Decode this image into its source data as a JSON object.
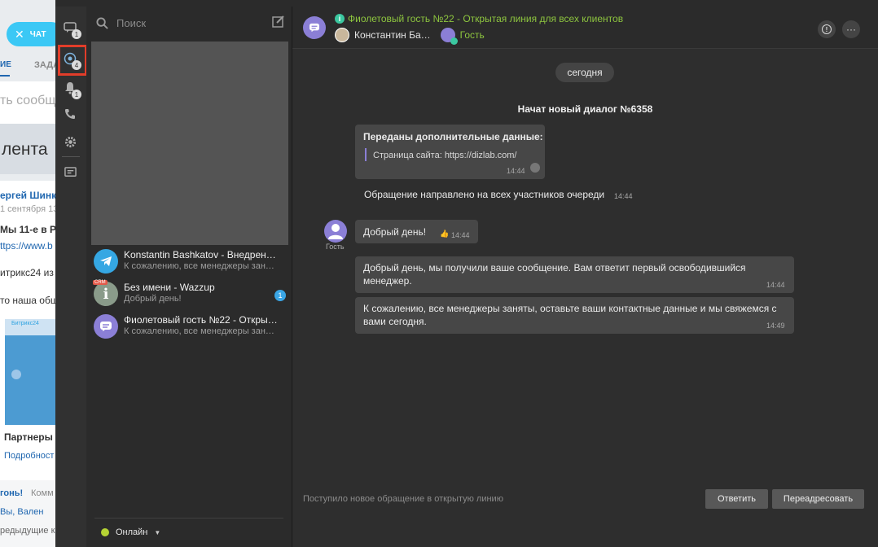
{
  "portal_bg": {
    "chat_button": "ЧАТ",
    "tab_active": "ИЕ",
    "tab_tasks": "ЗАДА",
    "placeholder": "ть сообще",
    "feed": "лента",
    "author": "ергей Шинк",
    "date": "1 сентября 13",
    "post_title": "Мы 11-е в Ро",
    "link": "ttps://www.b",
    "text1": "итрикс24 из",
    "text2": "то наша обш",
    "partners": "Партнеры",
    "more": "Подробност",
    "comment_author": "гонь!",
    "comment_label": "Комм",
    "you": "Вы, Вален",
    "prev": "редыдущие к"
  },
  "rail": {
    "chats_badge": "1",
    "openlines_badge": "4",
    "notifications_badge": "1"
  },
  "list": {
    "search_placeholder": "Поиск",
    "items": [
      {
        "name": "Konstantin Bashkatov - Внедрен…",
        "message": "К сожалению, все менеджеры зан…",
        "icon": "telegram-icon",
        "color": "#35a7e3"
      },
      {
        "name": "Без имени - Wazzup",
        "message": "Добрый день!",
        "icon": "info-icon",
        "color": "#8a9b8a",
        "badge": "1",
        "tag": "CRM"
      },
      {
        "name": "Фиолетовый гость №22 - Откры…",
        "message": "К сожалению, все менеджеры зан…",
        "icon": "openline-icon",
        "color": "#8b7fd6"
      }
    ],
    "status": "Онлайн"
  },
  "dialog": {
    "title": "Фиолетовый гость №22 - Открытая линия для всех клиентов",
    "operator": "Константин Ба…",
    "guest": "Гость",
    "date_divider": "сегодня",
    "new_dialog": "Начат новый диалог №6358",
    "extra_data_title": "Переданы дополнительные данные:",
    "extra_data_line": "Страница сайта: https://dizlab.com/",
    "extra_data_time": "14:44",
    "system_message": "Обращение направлено на всех участников очереди",
    "system_time": "14:44",
    "guest_label": "Гость",
    "guest_message": "Добрый день!",
    "guest_time": "14:44",
    "bot_message1": "Добрый день, мы получили ваше сообщение. Вам ответит первый освободившийся менеджер.",
    "bot_time1": "14:44",
    "bot_message2": "К сожалению, все менеджеры заняты, оставьте ваши контактные данные и мы свяжемся с вами сегодня.",
    "bot_time2": "14:49",
    "footer_text": "Поступило новое обращение в открытую линию",
    "answer_button": "Ответить",
    "redirect_button": "Переадресовать"
  },
  "colors": {
    "accent": "#3bc8f5",
    "green": "#8ec63f",
    "highlight": "#e23d2a",
    "online": "#b5d334"
  }
}
